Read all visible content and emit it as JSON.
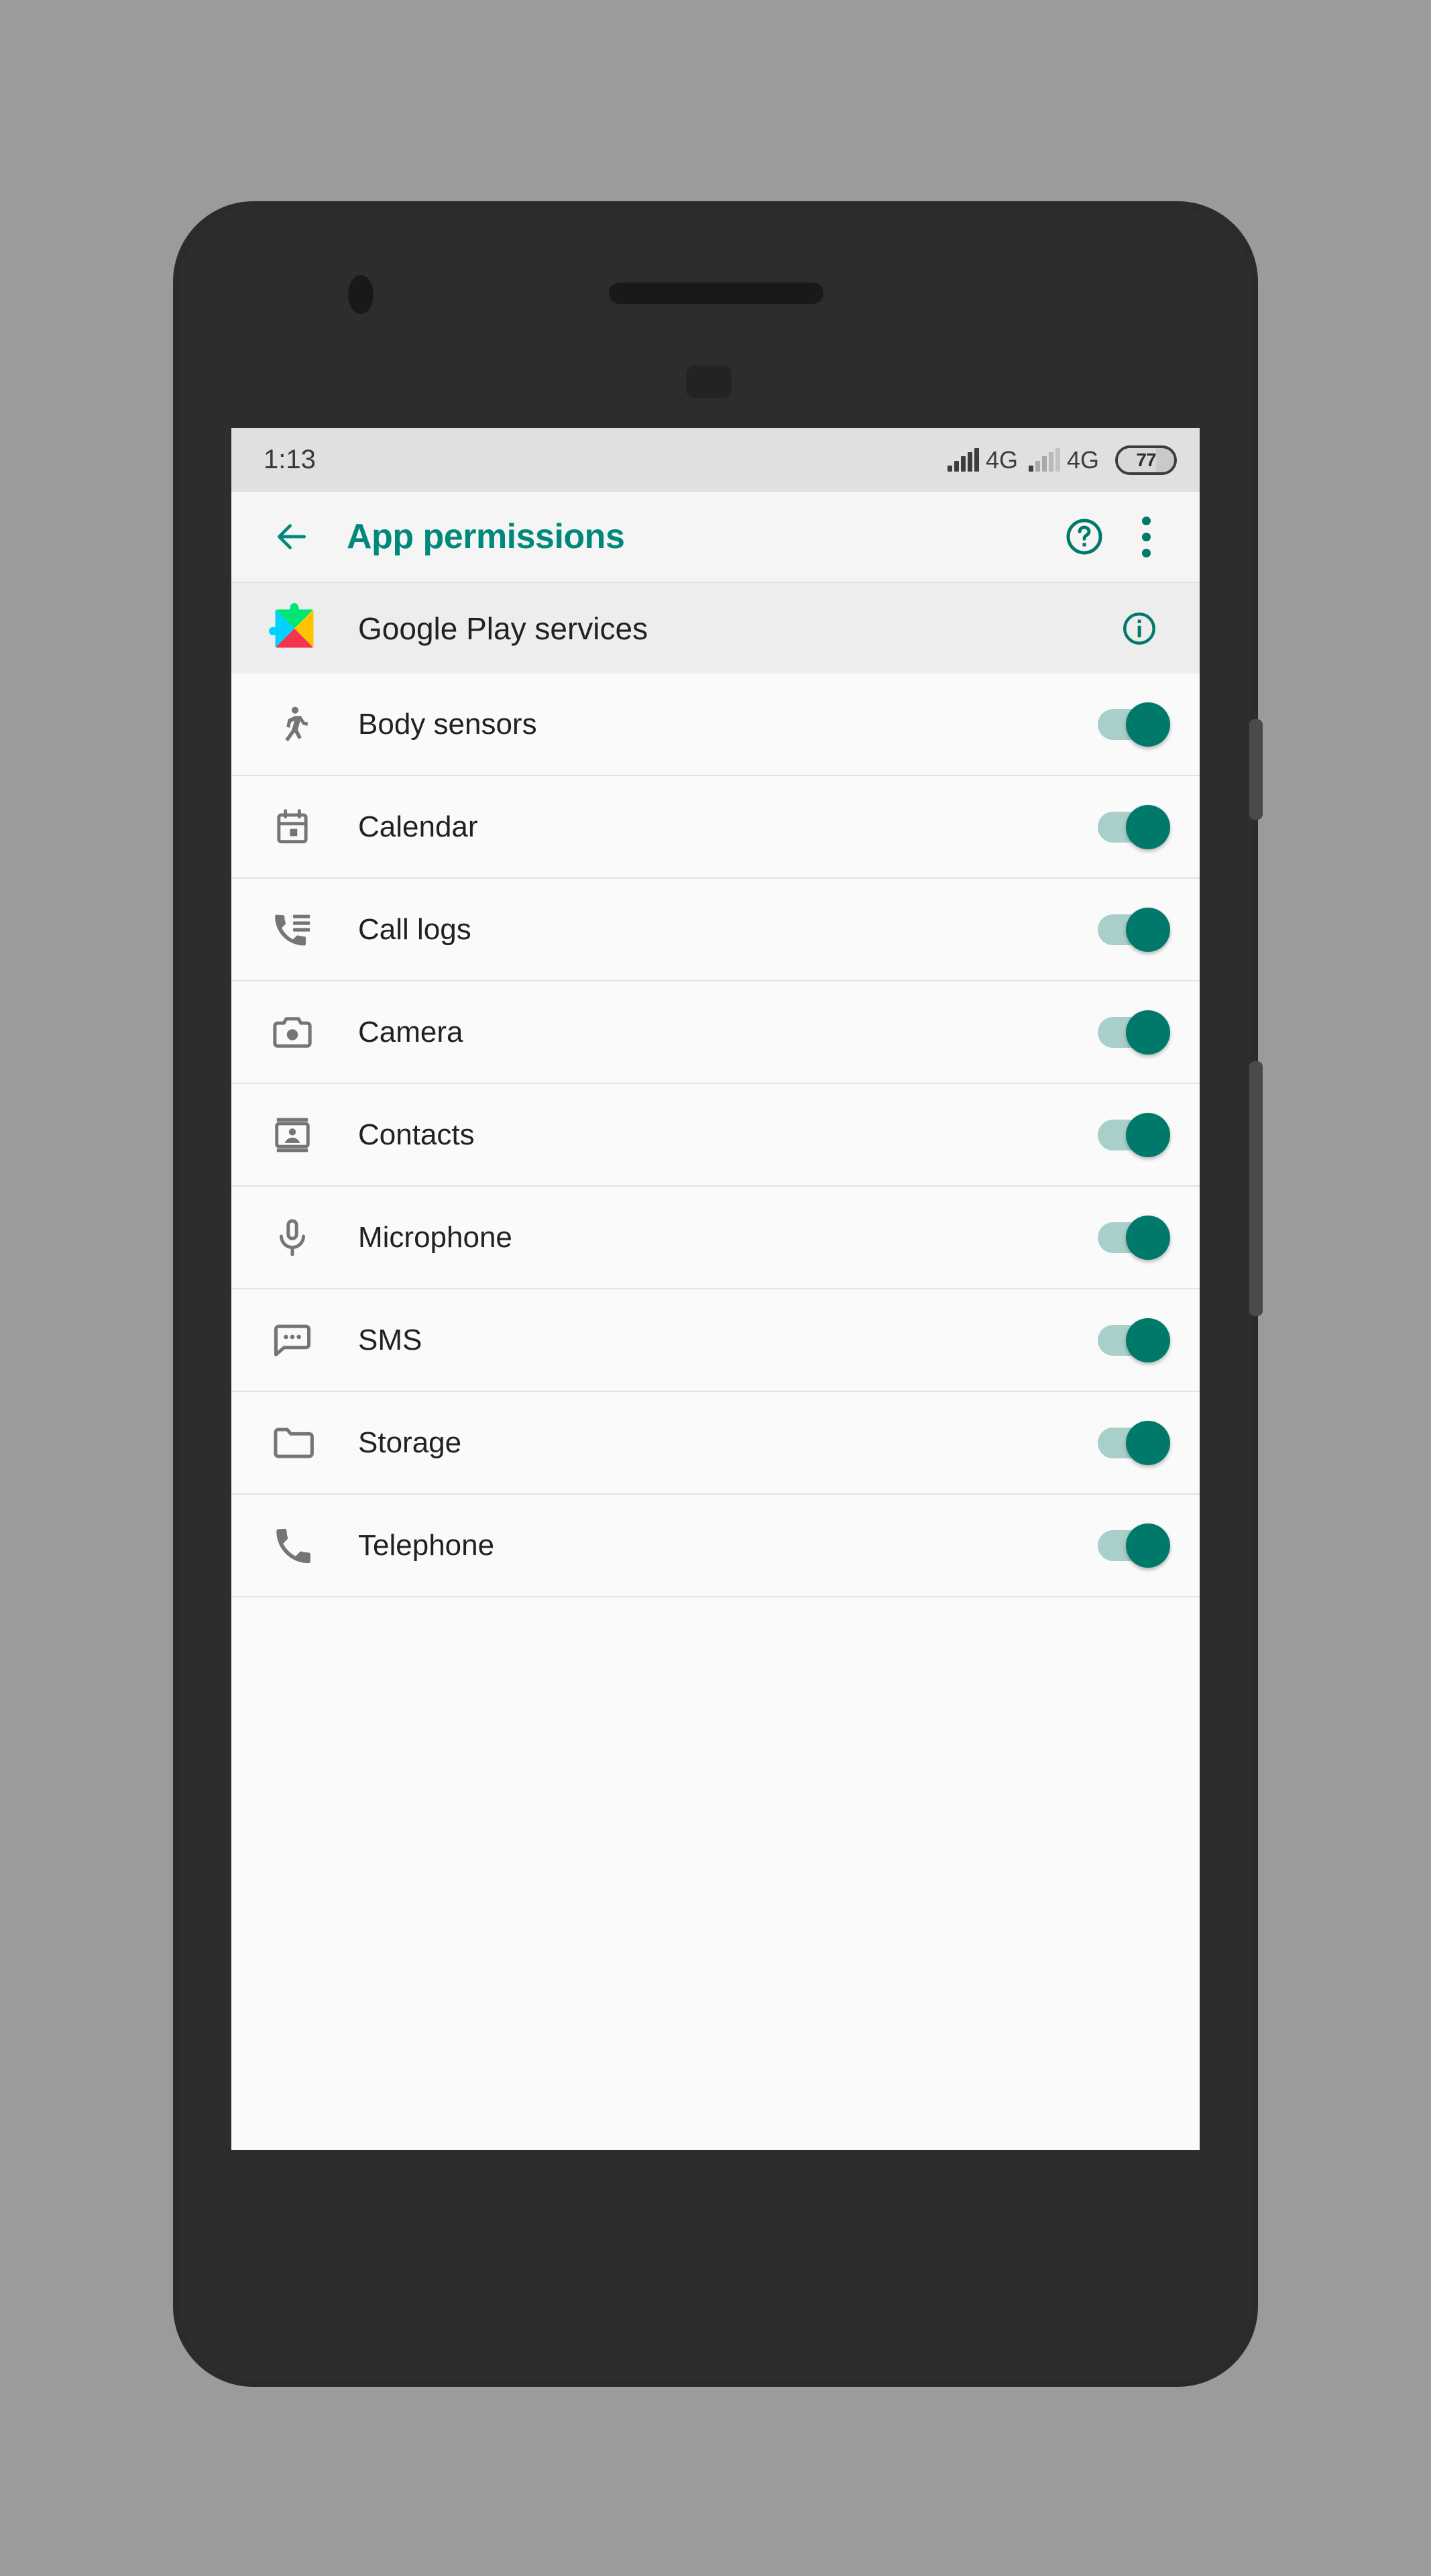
{
  "theme": {
    "accent": "#00897B",
    "accent_dark": "#00796B",
    "switch_track": "#a9cfcb",
    "screen_bg": "#fafafa",
    "statusbar_bg": "#e0e0e0",
    "toolbar_bg": "#f5f5f5",
    "app_row_bg": "#ededed",
    "device_body": "#2d2d2d",
    "wallpaper": "#9b9b9b"
  },
  "statusbar": {
    "clock": "1:13",
    "sim1_network": "4G",
    "sim2_network": "4G",
    "battery_percent": "77",
    "sim1_signal_bars": 5,
    "sim2_signal_bars": 1,
    "signal_icon": "signal-bars-icon",
    "battery_icon": "battery-icon"
  },
  "toolbar": {
    "back_icon": "arrow-left-icon",
    "title": "App permissions",
    "help_icon": "help-circle-icon",
    "overflow_icon": "more-vert-icon"
  },
  "app": {
    "name": "Google Play services",
    "icon": "google-play-services-icon",
    "info_icon": "info-circle-icon",
    "icon_colors": {
      "cyan": "#00d2ff",
      "green": "#00e676",
      "yellow": "#ffc400",
      "red": "#f5334f"
    }
  },
  "permissions": [
    {
      "label": "Body sensors",
      "icon": "body-sensors-icon",
      "enabled": true
    },
    {
      "label": "Calendar",
      "icon": "calendar-icon",
      "enabled": true
    },
    {
      "label": "Call logs",
      "icon": "call-logs-icon",
      "enabled": true
    },
    {
      "label": "Camera",
      "icon": "camera-icon",
      "enabled": true
    },
    {
      "label": "Contacts",
      "icon": "contacts-icon",
      "enabled": true
    },
    {
      "label": "Microphone",
      "icon": "microphone-icon",
      "enabled": true
    },
    {
      "label": "SMS",
      "icon": "sms-icon",
      "enabled": true
    },
    {
      "label": "Storage",
      "icon": "storage-icon",
      "enabled": true
    },
    {
      "label": "Telephone",
      "icon": "telephone-icon",
      "enabled": true
    }
  ],
  "device": {
    "camera_icon": "front-camera-icon",
    "speaker_icon": "earpiece-speaker-icon",
    "sensor_icon": "proximity-sensor-icon",
    "power_button": "power-button",
    "volume_button": "volume-button"
  }
}
